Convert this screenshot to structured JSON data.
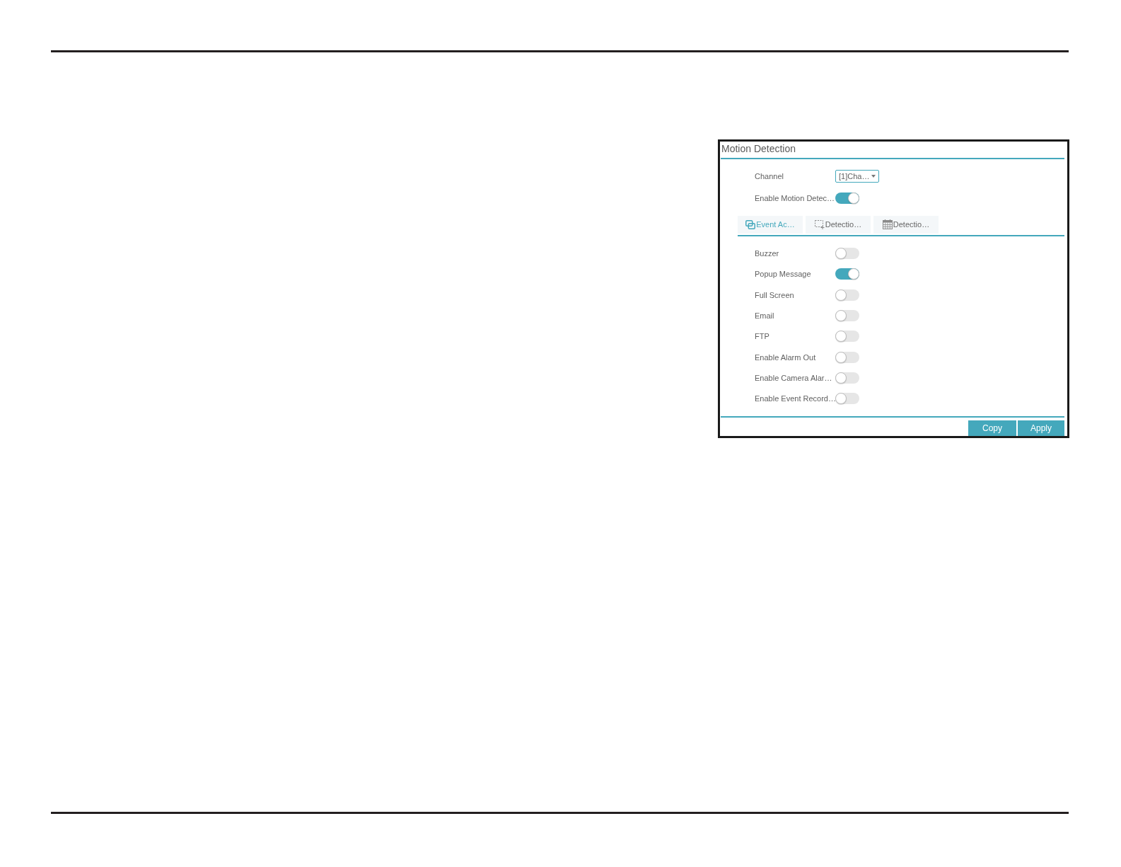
{
  "panel": {
    "title": "Motion Detection",
    "fields": [
      {
        "kind": "select",
        "label": "Channel",
        "value": "[1]Cha…"
      },
      {
        "kind": "switch",
        "label": "Enable Motion Detec…",
        "on": true
      }
    ],
    "tabs": [
      {
        "label": "Event Ac…",
        "selected": true
      },
      {
        "label": "Detectio…",
        "selected": false
      },
      {
        "label": "Detectio…",
        "selected": false
      }
    ],
    "actions": [
      {
        "label": "Buzzer",
        "on": false
      },
      {
        "label": "Popup Message",
        "on": true
      },
      {
        "label": "Full Screen",
        "on": false
      },
      {
        "label": "Email",
        "on": false
      },
      {
        "label": "FTP",
        "on": false
      },
      {
        "label": "Enable Alarm Out",
        "on": false
      },
      {
        "label": "Enable Camera Alar…",
        "on": false
      },
      {
        "label": "Enable Event Record…",
        "on": false
      }
    ],
    "buttons": [
      "Copy",
      "Apply"
    ]
  }
}
